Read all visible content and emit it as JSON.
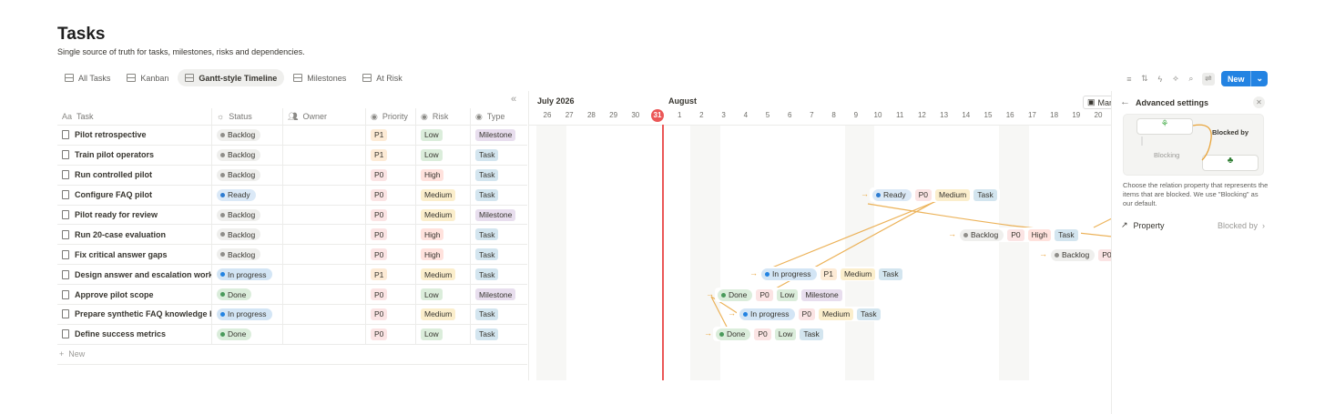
{
  "page": {
    "title": "Tasks",
    "subtitle": "Single source of truth for tasks, milestones, risks and dependencies."
  },
  "tabs": [
    {
      "label": "All Tasks"
    },
    {
      "label": "Kanban"
    },
    {
      "label": "Gantt-style Timeline"
    },
    {
      "label": "Milestones"
    },
    {
      "label": "At Risk"
    }
  ],
  "toolbar": {
    "new_label": "New"
  },
  "columns": {
    "task": "Task",
    "status": "Status",
    "owner": "Owner",
    "priority": "Priority",
    "risk": "Risk",
    "type": "Type"
  },
  "rows": [
    {
      "task": "Pilot retrospective",
      "status": "Backlog",
      "priority": "P1",
      "risk": "Low",
      "type": "Milestone"
    },
    {
      "task": "Train pilot operators",
      "status": "Backlog",
      "priority": "P1",
      "risk": "Low",
      "type": "Task"
    },
    {
      "task": "Run controlled pilot",
      "status": "Backlog",
      "priority": "P0",
      "risk": "High",
      "type": "Task"
    },
    {
      "task": "Configure FAQ pilot",
      "status": "Ready",
      "priority": "P0",
      "risk": "Medium",
      "type": "Task"
    },
    {
      "task": "Pilot ready for review",
      "status": "Backlog",
      "priority": "P0",
      "risk": "Medium",
      "type": "Milestone"
    },
    {
      "task": "Run 20-case evaluation",
      "status": "Backlog",
      "priority": "P0",
      "risk": "High",
      "type": "Task"
    },
    {
      "task": "Fix critical answer gaps",
      "status": "Backlog",
      "priority": "P0",
      "risk": "High",
      "type": "Task"
    },
    {
      "task": "Design answer and escalation workflo",
      "status": "In progress",
      "priority": "P1",
      "risk": "Medium",
      "type": "Task"
    },
    {
      "task": "Approve pilot scope",
      "status": "Done",
      "priority": "P0",
      "risk": "Low",
      "type": "Milestone"
    },
    {
      "task": "Prepare synthetic FAQ knowledge bas",
      "status": "In progress",
      "priority": "P0",
      "risk": "Medium",
      "type": "Task"
    },
    {
      "task": "Define success metrics",
      "status": "Done",
      "priority": "P0",
      "risk": "Low",
      "type": "Task"
    }
  ],
  "new_row": "New",
  "timeline": {
    "months": [
      "July 2026",
      "August"
    ],
    "days": [
      "26",
      "27",
      "28",
      "29",
      "30",
      "31",
      "1",
      "2",
      "3",
      "4",
      "5",
      "6",
      "7",
      "8",
      "9",
      "10",
      "11",
      "12",
      "13",
      "14",
      "15",
      "16",
      "17",
      "18",
      "19",
      "20"
    ],
    "today": "31",
    "view_button": "Man",
    "bars": [
      {
        "status": "Ready",
        "priority": "P0",
        "risk": "Medium",
        "type": "Task"
      },
      {
        "status": "Backlog",
        "priority": "P0",
        "risk": "High",
        "type": "Task"
      },
      {
        "status": "Backlog",
        "priority": "P0"
      },
      {
        "status": "In progress",
        "priority": "P1",
        "risk": "Medium",
        "type": "Task"
      },
      {
        "status": "Done",
        "priority": "P0",
        "risk": "Low",
        "type": "Milestone"
      },
      {
        "status": "In progress",
        "priority": "P0",
        "risk": "Medium",
        "type": "Task"
      },
      {
        "status": "Done",
        "priority": "P0",
        "risk": "Low",
        "type": "Task"
      }
    ]
  },
  "panel": {
    "title": "Advanced settings",
    "blocked_by": "Blocked by",
    "blocking": "Blocking",
    "description": "Choose the relation property that represents the items that are blocked. We use \"Blocking\" as our default.",
    "property_label": "Property",
    "property_value": "Blocked by"
  },
  "colors": {
    "accent": "#2383e2",
    "today": "#eb5757",
    "dependency": "#e9a53c"
  }
}
